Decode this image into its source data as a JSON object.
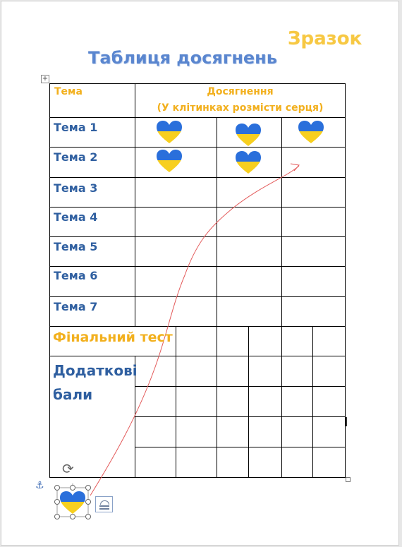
{
  "sample_label": "Зразок",
  "title": "Таблиця досягнень",
  "table": {
    "header_topic": "Тема",
    "header_achievements": "Досягнення",
    "header_instruction": "(У клітинках розмісти серця)",
    "topics": [
      "Тема 1",
      "Тема 2",
      "Тема 3",
      "Тема 4",
      "Тема 5",
      "Тема 6",
      "Тема 7"
    ],
    "final_test": "Фінальний тест",
    "extra_points": "Додаткові бали"
  },
  "hearts": {
    "topic_1_count": 3,
    "topic_2_count": 2
  },
  "icons": {
    "heart": "ukraine-flag-heart-icon",
    "move": "move-crosshair-icon",
    "anchor": "anchor-icon",
    "rotate": "rotate-handle-icon",
    "layout": "layout-options-icon"
  },
  "colors": {
    "title": "#5a86cf",
    "sample": "#f7c843",
    "header": "#f2b01e",
    "topic": "#2f5fa0",
    "heart_top": "#2a6fdb",
    "heart_bottom": "#f7cf1f",
    "arrow": "#e35a5a"
  }
}
